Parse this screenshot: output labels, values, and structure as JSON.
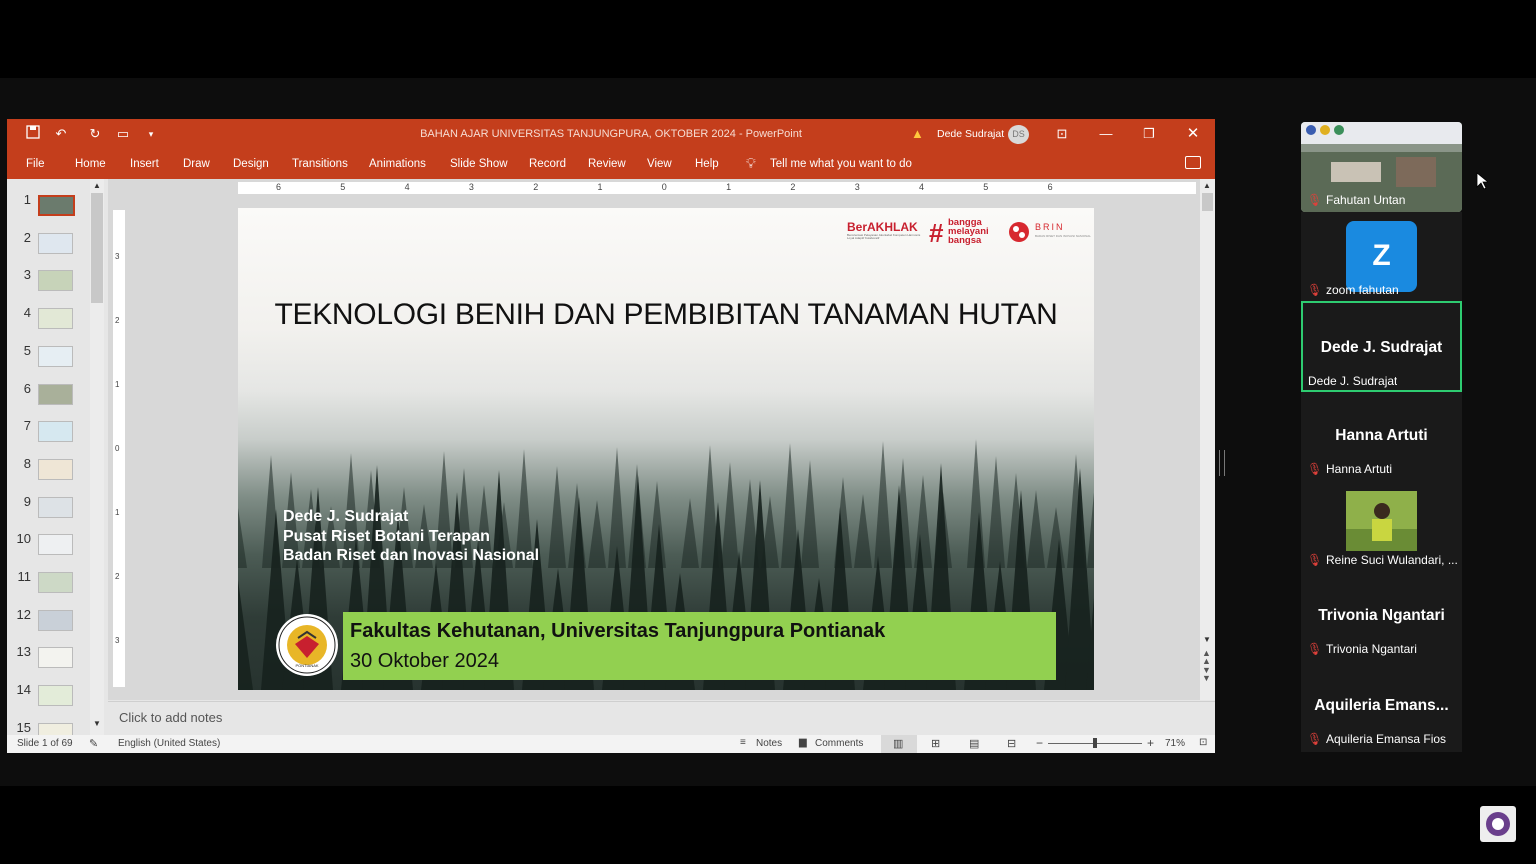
{
  "window": {
    "title": "BAHAN AJAR UNIVERSITAS TANJUNGPURA, OKTOBER 2024  -  PowerPoint",
    "user_name": "Dede Sudrajat",
    "user_initials": "DS"
  },
  "ribbon": {
    "tabs": [
      "File",
      "Home",
      "Insert",
      "Draw",
      "Design",
      "Transitions",
      "Animations",
      "Slide Show",
      "Record",
      "Review",
      "View",
      "Help"
    ],
    "tell_me": "Tell me what you want to do"
  },
  "thumbnails": [
    "1",
    "2",
    "3",
    "4",
    "5",
    "6",
    "7",
    "8",
    "9",
    "10",
    "11",
    "12",
    "13",
    "14",
    "15"
  ],
  "ruler": {
    "h_ticks": [
      "6",
      "5",
      "4",
      "3",
      "2",
      "1",
      "0",
      "1",
      "2",
      "3",
      "4",
      "5",
      "6"
    ],
    "v_ticks": [
      "3",
      "2",
      "1",
      "0",
      "1",
      "2",
      "3"
    ]
  },
  "slide": {
    "logo_berakhlak": "BerAKHLAK",
    "logo_berakhlak_sub": "Berorientasi Pelayanan Akuntabel Kompeten Harmonis Loyal Adaptif Kolaboratif",
    "logo_bangga": [
      "bangga",
      "melayani",
      "bangsa"
    ],
    "logo_brin": "BRIN",
    "logo_brin_sub": "BADAN RISET DAN INOVASI NASIONAL",
    "title": "TEKNOLOGI BENIH DAN PEMBIBITAN TANAMAN HUTAN",
    "author": "Dede J. Sudrajat",
    "affil1": "Pusat Riset Botani Terapan",
    "affil2": "Badan Riset dan Inovasi Nasional",
    "banner_line1": "Fakultas Kehutanan, Universitas Tanjungpura Pontianak",
    "banner_line2": "30 Oktober 2024",
    "seal_text": "PONTIANAK"
  },
  "notes_placeholder": "Click to add notes",
  "status": {
    "slide_info": "Slide 1 of 69",
    "language": "English (United States)",
    "notes_label": "Notes",
    "comments_label": "Comments",
    "zoom": "71%",
    "zoom_value": 0.5
  },
  "participants": [
    {
      "label": "Fahutan Untan",
      "type": "video",
      "muted": true
    },
    {
      "label": "zoom fahutan",
      "type": "avatar",
      "avatar_letter": "Z",
      "muted": true
    },
    {
      "label": "Dede J. Sudrajat",
      "display": "Dede J. Sudrajat",
      "type": "name",
      "active_speaker": true,
      "muted": false
    },
    {
      "label": "Hanna Artuti",
      "display": "Hanna Artuti",
      "type": "name",
      "muted": true
    },
    {
      "label": "Reine Suci Wulandari, ...",
      "type": "video",
      "muted": true
    },
    {
      "label": "Trivonia Ngantari",
      "display": "Trivonia Ngantari",
      "type": "name",
      "muted": true
    },
    {
      "label": "Aquileria Emansa Fios",
      "display": "Aquileria  Emans...",
      "type": "name",
      "muted": true
    }
  ],
  "colors": {
    "ppt_accent": "#c43e1c",
    "active_speaker": "#2ecc71",
    "banner_green": "#92d050",
    "zoom_blue": "#1a8ae0",
    "muted_red": "#e0403a"
  }
}
